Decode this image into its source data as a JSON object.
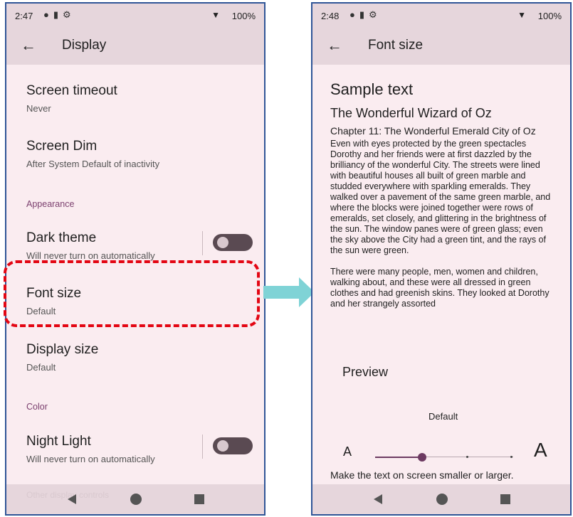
{
  "left": {
    "status": {
      "time": "2:47",
      "battery": "100%"
    },
    "app_bar": {
      "title": "Display"
    },
    "items": [
      {
        "title": "Screen timeout",
        "subtitle": "Never"
      },
      {
        "title": "Screen Dim",
        "subtitle": "After System Default of inactivity"
      },
      {
        "title": "Dark theme",
        "subtitle": "Will never turn on automatically"
      },
      {
        "title": "Font size",
        "subtitle": "Default"
      },
      {
        "title": "Display size",
        "subtitle": "Default"
      },
      {
        "title": "Night Light",
        "subtitle": "Will never turn on automatically"
      }
    ],
    "sections": {
      "appearance": "Appearance",
      "color": "Color",
      "other": "Other display controls"
    },
    "toggles": {
      "dark_theme": false,
      "night_light": false
    }
  },
  "right": {
    "status": {
      "time": "2:48",
      "battery": "100%"
    },
    "app_bar": {
      "title": "Font size"
    },
    "sample_title": "Sample text",
    "book_title": "The Wonderful Wizard of Oz",
    "chapter": "Chapter 11: The Wonderful Emerald City of Oz",
    "paragraph1": "Even with eyes protected by the green spectacles Dorothy and her friends were at first dazzled by the brilliancy of the wonderful City. The streets were lined with beautiful houses all built of green marble and studded everywhere with sparkling emeralds. They walked over a pavement of the same green marble, and where the blocks were joined together were rows of emeralds, set closely, and glittering in the brightness of the sun. The window panes were of green glass; even the sky above the City had a green tint, and the rays of the sun were green.",
    "paragraph2": "There were many people, men, women and children, walking about, and these were all dressed in green clothes and had greenish skins. They looked at Dorothy and her strangely assorted",
    "preview_label": "Preview",
    "current_size": "Default",
    "small_a": "A",
    "large_a": "A",
    "hint": "Make the text on screen smaller or larger.",
    "slider": {
      "steps": 4,
      "selected_index": 1
    }
  },
  "colors": {
    "highlight": "#e30613",
    "arrow": "#7fd3d6",
    "accent": "#6d3a62"
  }
}
